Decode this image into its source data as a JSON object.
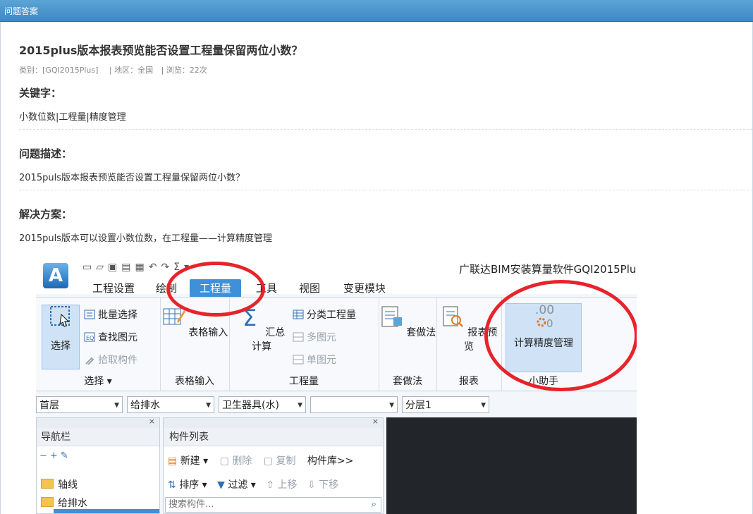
{
  "header": {
    "title": "问题答案"
  },
  "question": {
    "title": "2015plus版本报表预览能否设置工程量保留两位小数？",
    "category": "类别：[GQI2015Plus]",
    "region": "| 地区：全国",
    "views": "|    浏览：22次"
  },
  "sections": {
    "keywords_title": "关键字：",
    "keywords": "小数位数|工程量|精度管理",
    "desc_title": "问题描述：",
    "desc": "2015puls版本报表预览能否设置工程量保留两位小数？",
    "solution_title": "解决方案：",
    "solution": "2015puls版本可以设置小数位数，在工程量——计算精度管理"
  },
  "app": {
    "logo": "A",
    "title": "广联达BIM安装算量软件GQI2015Plu",
    "tabs": [
      "工程设置",
      "绘制",
      "工程量",
      "工具",
      "视图",
      "变更模块"
    ],
    "active_tab": "工程量",
    "ribbon": {
      "select_big": "选择",
      "batch_select": "批量选择",
      "find_element": "查找图元",
      "pick_component": "拾取构件",
      "group_select": "选择 ▾",
      "table_input_big": "表格输入",
      "group_table": "表格输入",
      "sum_calc": "汇总计算",
      "classify_qty": "分类工程量",
      "multi_element": "多图元",
      "single_element": "单图元",
      "group_qty": "工程量",
      "set_method": "套做法",
      "group_set": "套做法",
      "report_preview": "报表预览",
      "group_report": "报表",
      "calc_precision": "计算精度管理",
      "calc_icon_text": ".00",
      "group_helper": "小助手"
    },
    "combos": [
      "首层",
      "给排水",
      "卫生器具(水)",
      "",
      "分层1"
    ],
    "nav": {
      "title": "导航栏",
      "items": [
        "轴线",
        "给排水"
      ]
    },
    "components": {
      "title": "构件列表",
      "new": "新建",
      "delete": "删除",
      "copy": "复制",
      "library": "构件库>>",
      "sort": "排序",
      "filter": "过滤",
      "move_up": "上移",
      "move_down": "下移",
      "search_placeholder": "搜索构件..."
    },
    "close_glyph": "×"
  }
}
